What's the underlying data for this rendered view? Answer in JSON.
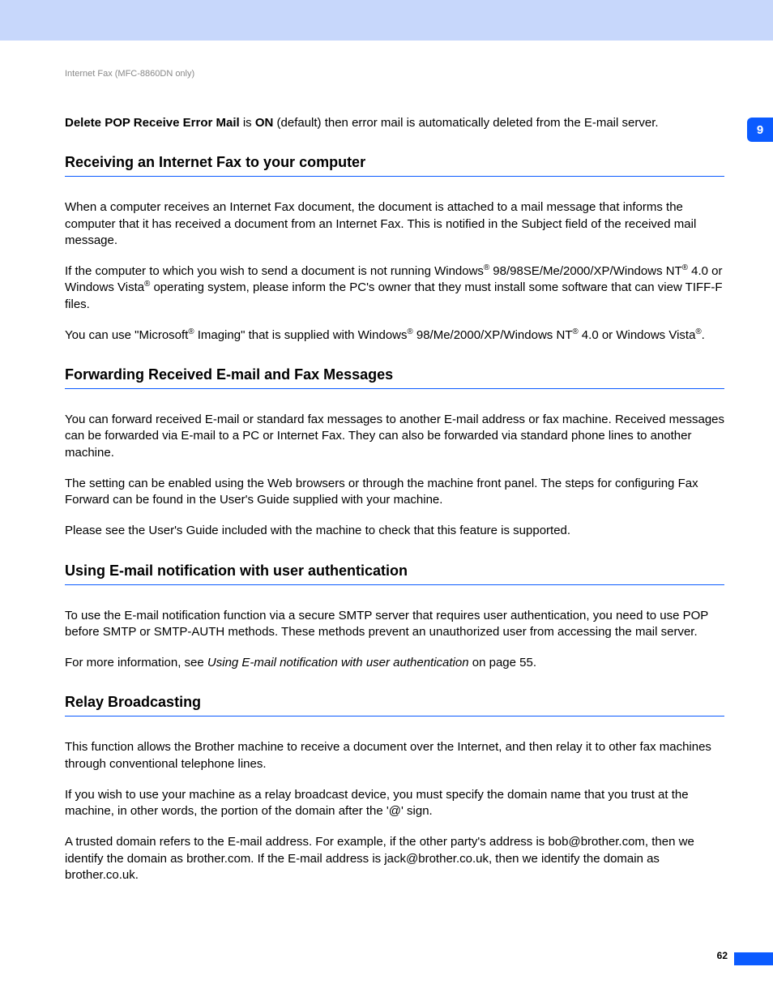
{
  "breadcrumb": "Internet Fax (MFC-8860DN only)",
  "chapter_tab": "9",
  "page_number": "62",
  "intro": {
    "bold1": "Delete POP Receive Error Mail",
    "mid1": " is ",
    "bold2": "ON",
    "tail": " (default) then error mail is automatically deleted from the E-mail server."
  },
  "sections": {
    "s1": {
      "heading": "Receiving an Internet Fax to your computer",
      "p1": "When a computer receives an Internet Fax document, the document is attached to a mail message that informs the computer that it has received a document from an Internet Fax. This is notified in the Subject field of the received mail message.",
      "p2a": "If the computer to which you wish to send a document is not running Windows",
      "p2b": " 98/98SE/Me/2000/XP/Windows NT",
      "p2c": " 4.0 or Windows Vista",
      "p2d": " operating system, please inform the PC's owner that they must install some software that can view TIFF-F files.",
      "p3a": "You can use \"Microsoft",
      "p3b": " Imaging\" that is supplied with Windows",
      "p3c": " 98/Me/2000/XP/Windows NT",
      "p3d": " 4.0 or Windows Vista",
      "p3e": "."
    },
    "s2": {
      "heading": "Forwarding Received E-mail and Fax Messages",
      "p1": "You can forward received E-mail or standard fax messages to another E-mail address or fax machine. Received messages can be forwarded via E-mail to a PC or Internet Fax. They can also be forwarded via standard phone lines to another machine.",
      "p2": "The setting can be enabled using the Web browsers or through the machine front panel. The steps for configuring Fax Forward can be found in the User's Guide supplied with your machine.",
      "p3": "Please see the User's Guide included with the machine to check that this feature is supported."
    },
    "s3": {
      "heading": "Using E-mail notification with user authentication",
      "p1": "To use the E-mail notification function via a secure SMTP server that requires user authentication, you need to use POP before SMTP or SMTP-AUTH methods. These methods prevent an unauthorized user from accessing the mail server.",
      "p2a": "For more information, see ",
      "p2link": "Using E-mail notification with user authentication",
      "p2b": " on page 55."
    },
    "s4": {
      "heading": "Relay Broadcasting",
      "p1": "This function allows the Brother machine to receive a document over the Internet, and then relay it to other fax machines through conventional telephone lines.",
      "p2": "If you wish to use your machine as a relay broadcast device, you must specify the domain name that you trust at the machine, in other words, the portion of the domain after the '@' sign.",
      "p3": "A trusted domain refers to the E-mail address. For example, if the other party's address is bob@brother.com, then we identify the domain as brother.com. If the E-mail address is jack@brother.co.uk, then we identify the domain as brother.co.uk."
    }
  },
  "reg": "®"
}
